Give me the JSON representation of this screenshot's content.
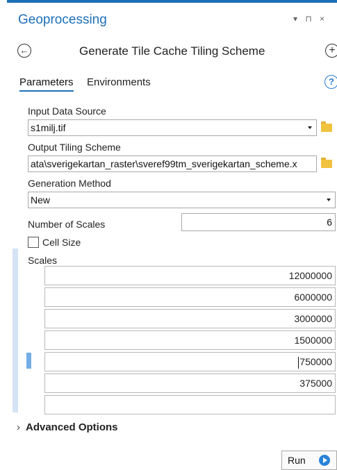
{
  "pane": {
    "title": "Geoprocessing",
    "controls": "▾ ⊓ ×"
  },
  "tool": {
    "back_icon": "back-arrow-icon",
    "title": "Generate Tile Cache Tiling Scheme",
    "add_icon": "add-icon"
  },
  "tabs": {
    "parameters": "Parameters",
    "environments": "Environments",
    "help_icon": "?"
  },
  "params": {
    "input_label": "Input Data Source",
    "input_value": "s1milj.tif",
    "output_label": "Output Tiling Scheme",
    "output_value": "ata\\sverigekartan_raster\\sveref99tm_sverigekartan_scheme.x",
    "method_label": "Generation Method",
    "method_value": "New",
    "num_scales_label": "Number of Scales",
    "num_scales_value": "6",
    "cell_size_label": "Cell Size",
    "cell_size_checked": false,
    "scales_label": "Scales",
    "scales": [
      "12000000",
      "6000000",
      "3000000",
      "1500000",
      "750000",
      "375000",
      ""
    ]
  },
  "advanced_label": "Advanced Options",
  "run_label": "Run",
  "colors": {
    "accent": "#1d6fb8",
    "folder": "#f0c23e",
    "run": "#2a83d8"
  }
}
